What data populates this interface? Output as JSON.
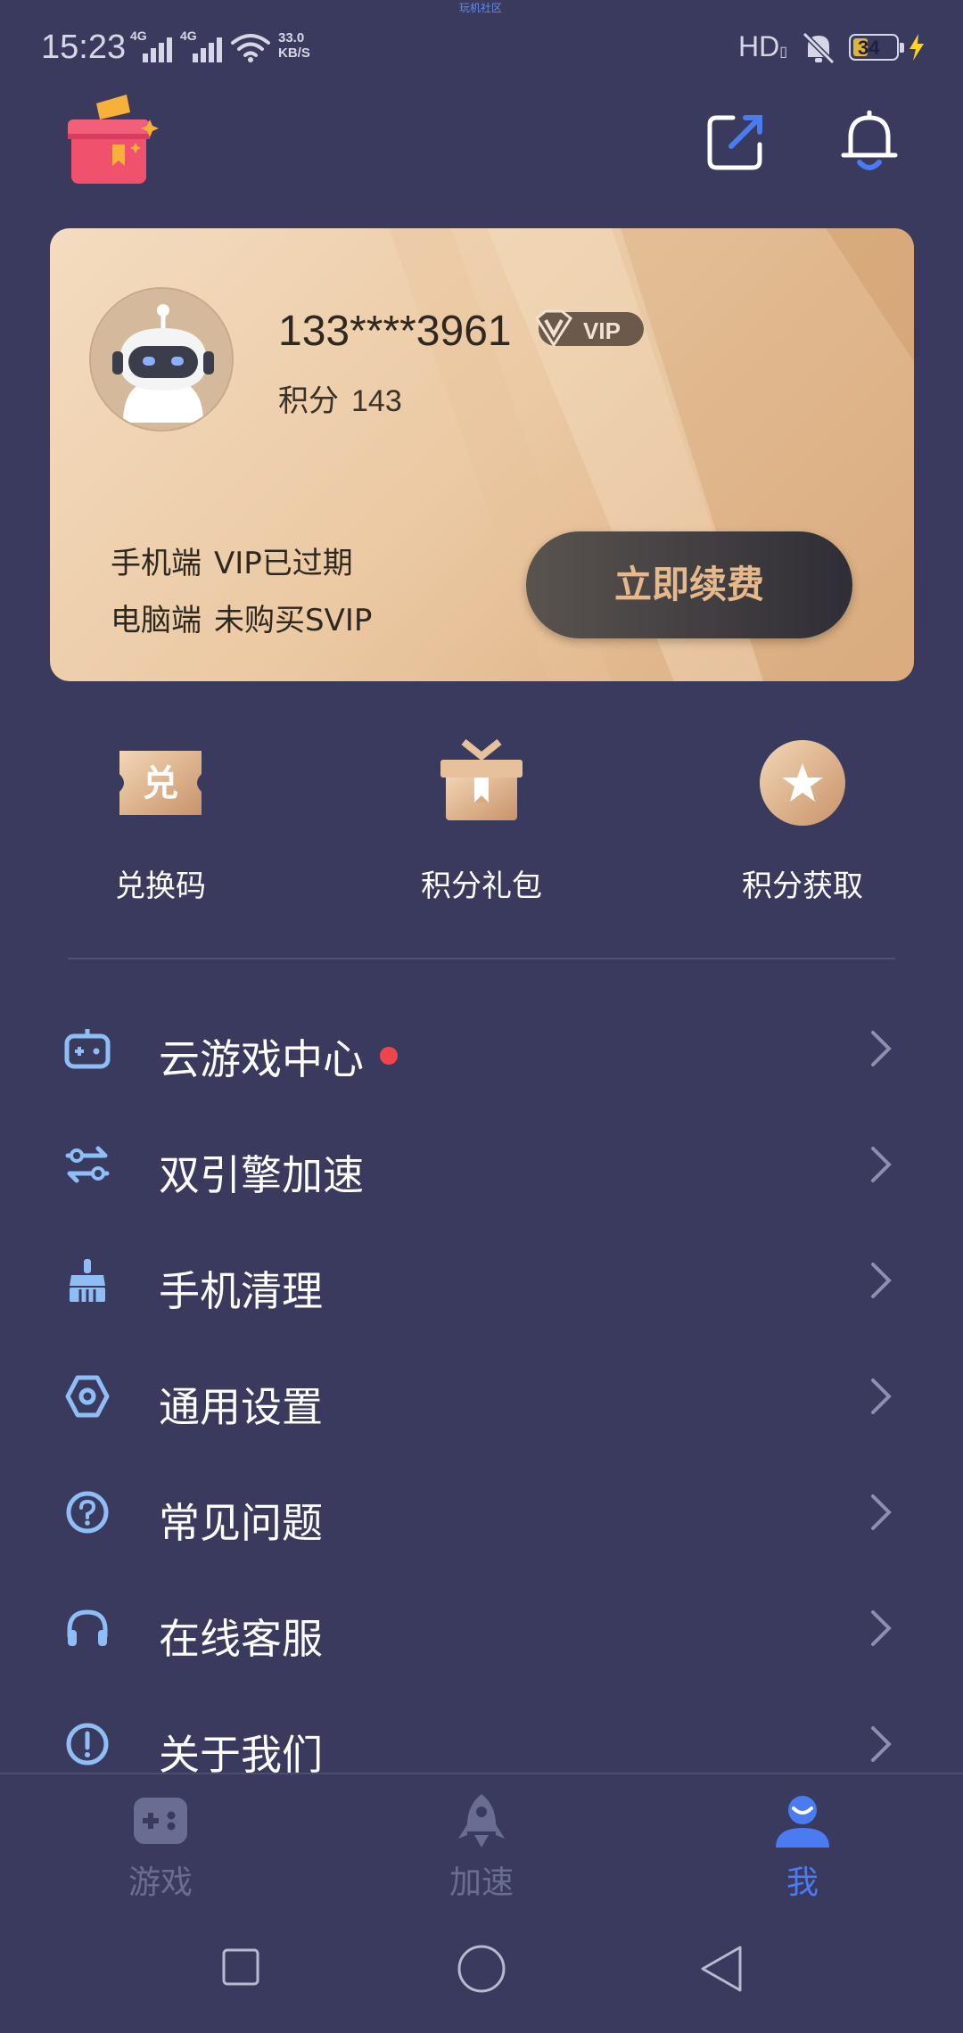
{
  "status_bar": {
    "time": "15:23",
    "signal1": "4G",
    "signal2": "4G",
    "net_speed_value": "33.0",
    "net_speed_unit": "KB/S",
    "watermark": "玩机社区",
    "hd": "HD",
    "battery": "34",
    "battery_color": "#e0b43a"
  },
  "header": {
    "icons": [
      "gift-icon",
      "share-edit-icon",
      "bell-icon"
    ]
  },
  "vip_card": {
    "phone": "133****3961",
    "vip_badge": "VIP",
    "points_label": "积分",
    "points_value": "143",
    "mobile_label": "手机端",
    "mobile_status": "VIP已过期",
    "pc_label": "电脑端",
    "pc_status": "未购买SVIP",
    "renew_button": "立即续费"
  },
  "quick_actions": [
    {
      "label": "兑换码",
      "icon": "redeem-ticket-icon"
    },
    {
      "label": "积分礼包",
      "icon": "gift-box-icon"
    },
    {
      "label": "积分获取",
      "icon": "star-coin-icon"
    }
  ],
  "menu": [
    {
      "label": "云游戏中心",
      "icon": "gamepad-icon",
      "badge_dot": true
    },
    {
      "label": "双引擎加速",
      "icon": "dual-engine-icon"
    },
    {
      "label": "手机清理",
      "icon": "broom-icon"
    },
    {
      "label": "通用设置",
      "icon": "hexagon-settings-icon"
    },
    {
      "label": "常见问题",
      "icon": "question-icon"
    },
    {
      "label": "在线客服",
      "icon": "headset-icon"
    },
    {
      "label": "关于我们",
      "icon": "info-icon"
    }
  ],
  "bottom_nav": [
    {
      "label": "游戏",
      "icon": "gamepad-icon",
      "active": false
    },
    {
      "label": "加速",
      "icon": "rocket-icon",
      "active": false
    },
    {
      "label": "我",
      "icon": "user-icon",
      "active": true
    }
  ],
  "colors": {
    "background": "#393a5e",
    "accent": "#4a7bf1",
    "menu_icon": "#8fbdf5",
    "badge_dot": "#f0444f",
    "card_gold": "#ebc9a3"
  }
}
